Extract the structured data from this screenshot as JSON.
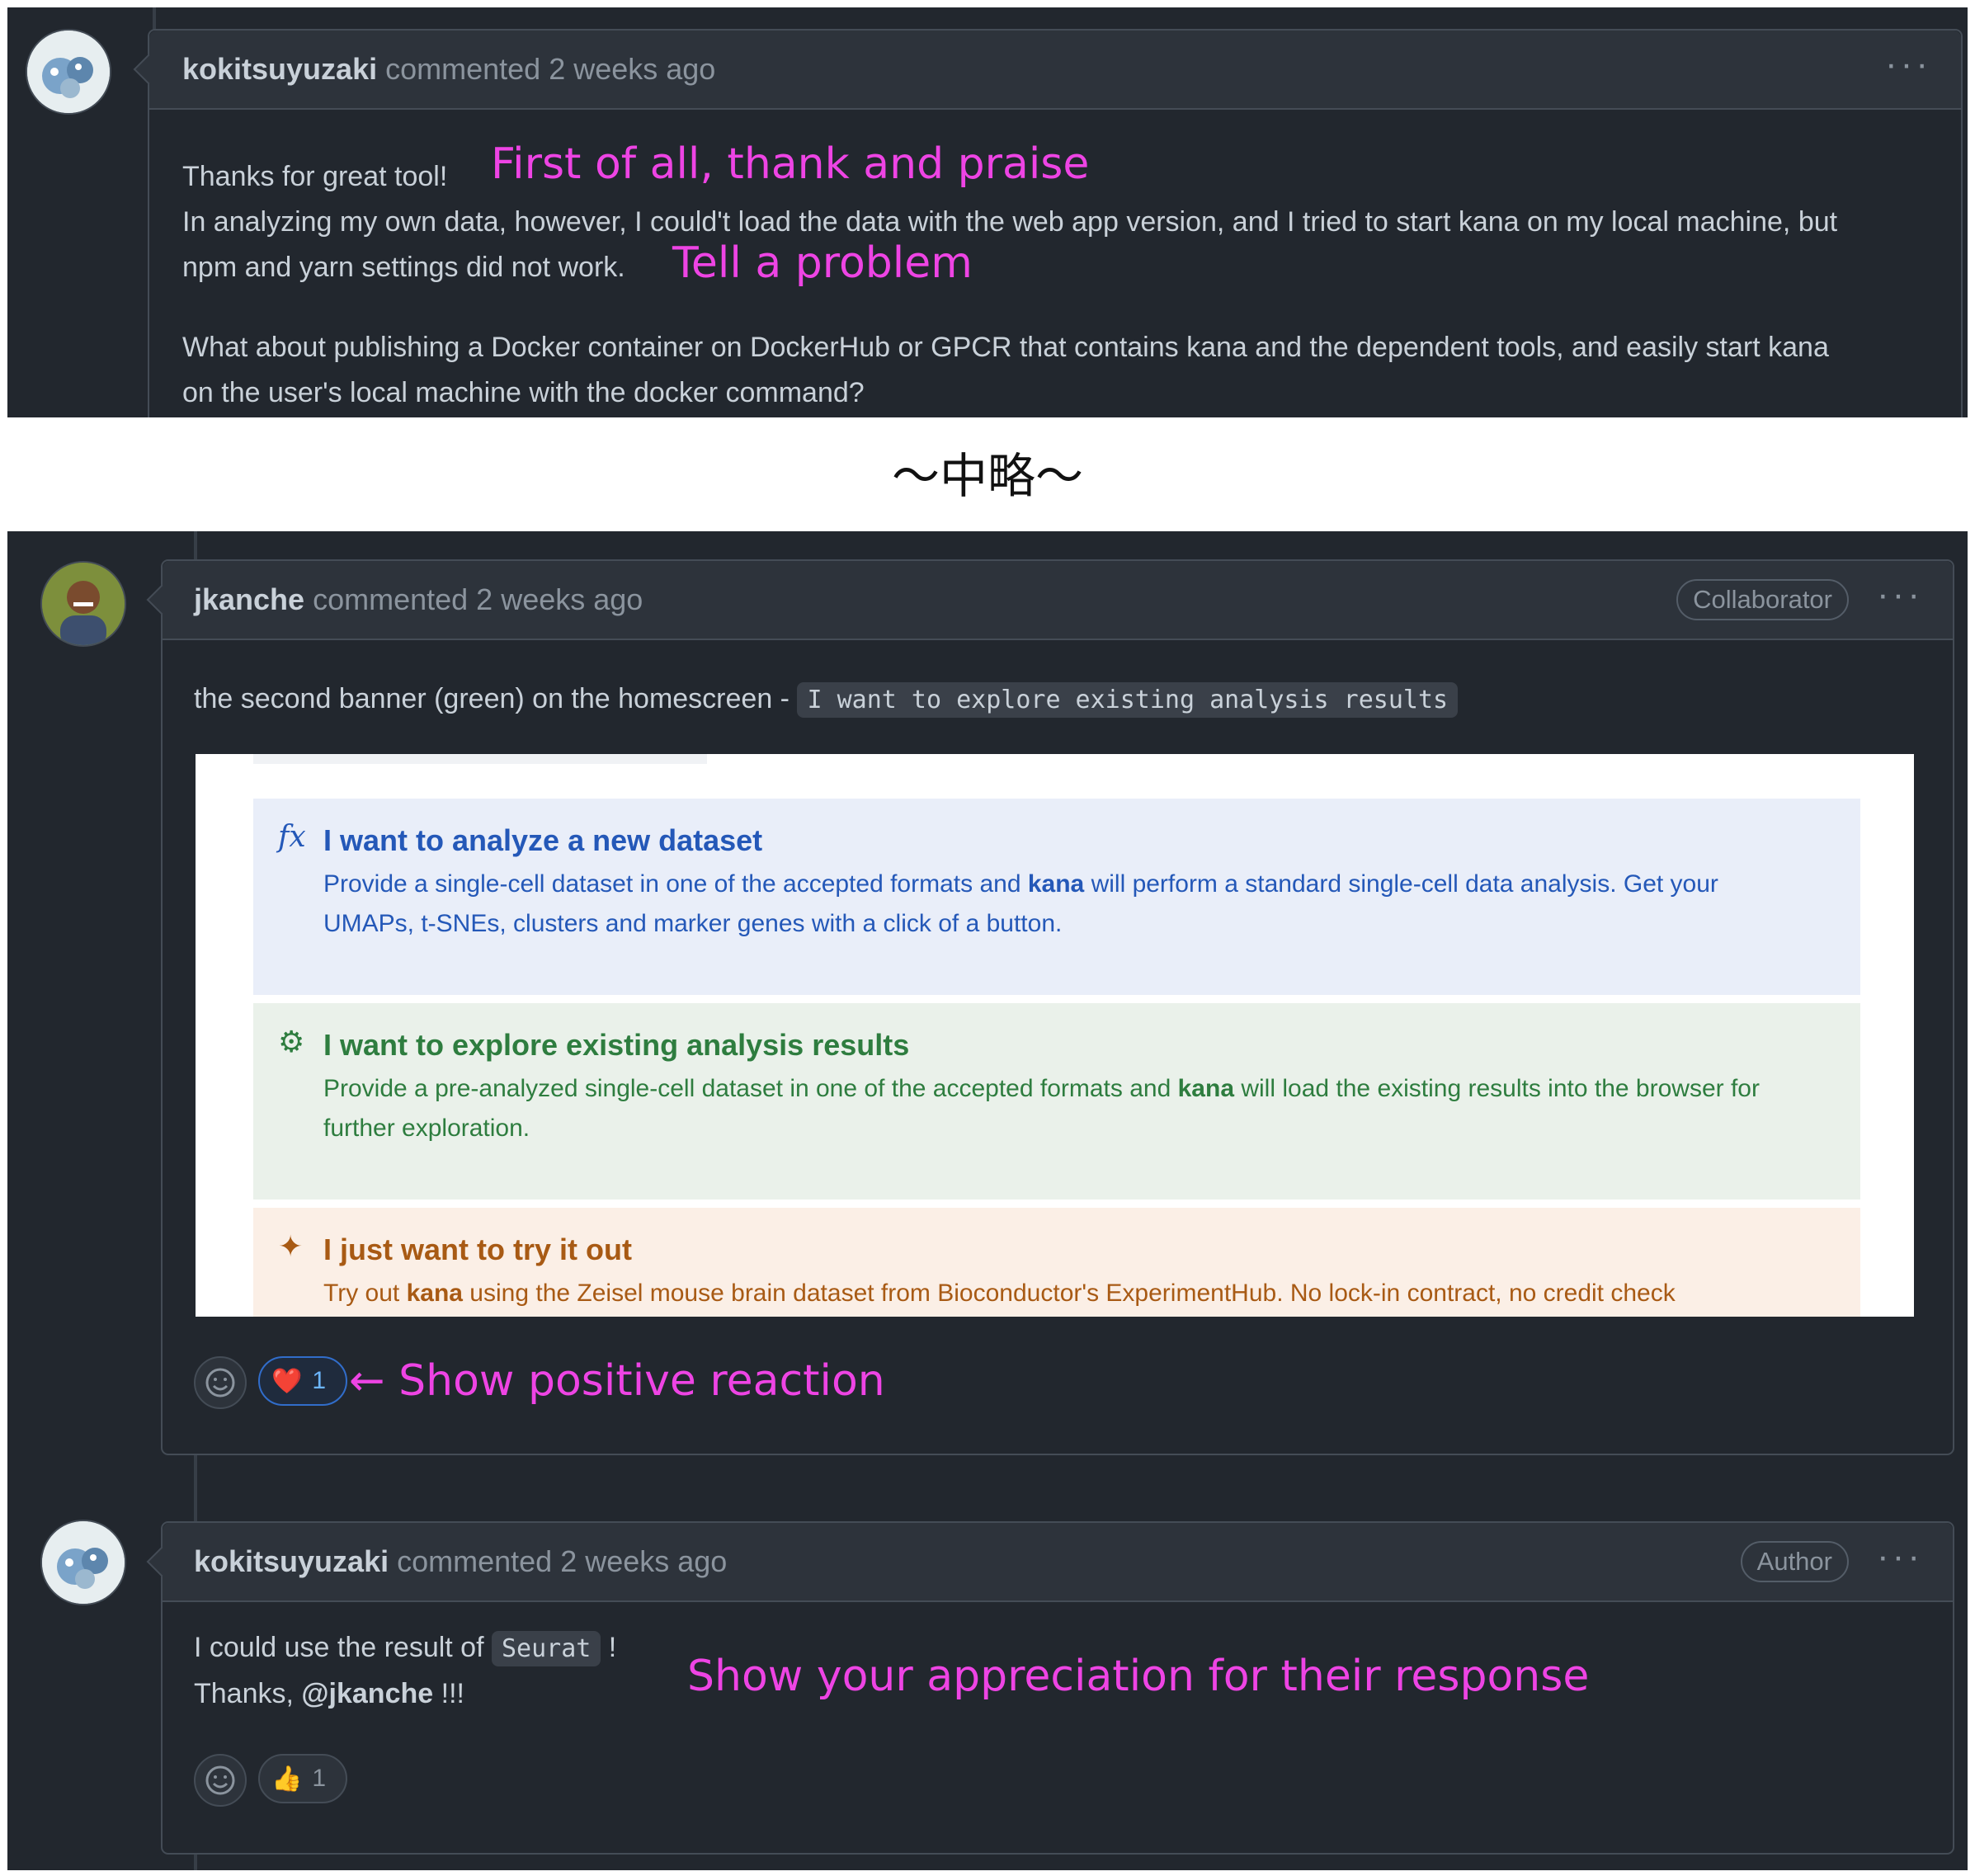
{
  "comment1": {
    "author": "kokitsuyuzaki",
    "meta": "commented 2 weeks ago",
    "line1": "Thanks for great tool!",
    "line2": "In analyzing my own data, however, I could't load the data with the web app version, and I tried to start kana on my local machine, but",
    "line3": "npm and yarn settings did not work.",
    "line4": "What about publishing a Docker container on DockerHub or GPCR that contains kana and the dependent tools, and easily start kana",
    "line5": "on the user's local machine with the docker command?",
    "note1": "First of all, thank and praise",
    "note2": "Tell a problem"
  },
  "separator": "〜中略〜",
  "comment2": {
    "author": "jkanche",
    "meta": "commented 2 weeks ago",
    "badge": "Collaborator",
    "text": "the second banner (green) on the homescreen - ",
    "code": "I want to explore existing analysis results",
    "reaction_emoji": "❤️",
    "reaction_count": "1",
    "note": "← Show positive reaction"
  },
  "screenshot": {
    "b1_icon": "𝑓𝑥",
    "b1_title": "I want to analyze a new dataset",
    "b1_desc_a": "Provide a single-cell dataset in one of the accepted formats and ",
    "b1_desc_b": "kana",
    "b1_desc_c": " will perform a standard single-cell data analysis. Get your UMAPs, t-SNEs, clusters and marker genes with a click of a button.",
    "b2_icon": "⚙",
    "b2_title": "I want to explore existing analysis results",
    "b2_desc_a": "Provide a pre-analyzed single-cell dataset in one of the accepted formats and ",
    "b2_desc_b": "kana",
    "b2_desc_c": " will load the existing results into the browser for further exploration.",
    "b3_icon": "✦",
    "b3_title": "I just want to try it out",
    "b3_desc_a": "Try out ",
    "b3_desc_b": "kana",
    "b3_desc_c": " using the Zeisel mouse brain dataset from Bioconductor's ExperimentHub. No lock-in contract, no credit check"
  },
  "comment3": {
    "author": "kokitsuyuzaki",
    "meta": "commented 2 weeks ago",
    "badge": "Author",
    "line1a": "I could use the result of ",
    "code": "Seurat",
    "line1b": " !",
    "line2a": "Thanks, ",
    "mention": "@jkanche",
    "line2b": " !!!",
    "reaction_emoji": "👍",
    "reaction_count": "1",
    "note": "Show your appreciation for their response"
  },
  "colors": {
    "annotation": "#ee44e4",
    "panel_bg": "#22272e",
    "banner_blue_bg": "#e9eef9",
    "banner_green_bg": "#eaf1ea",
    "banner_orange_bg": "#fbefe6"
  }
}
